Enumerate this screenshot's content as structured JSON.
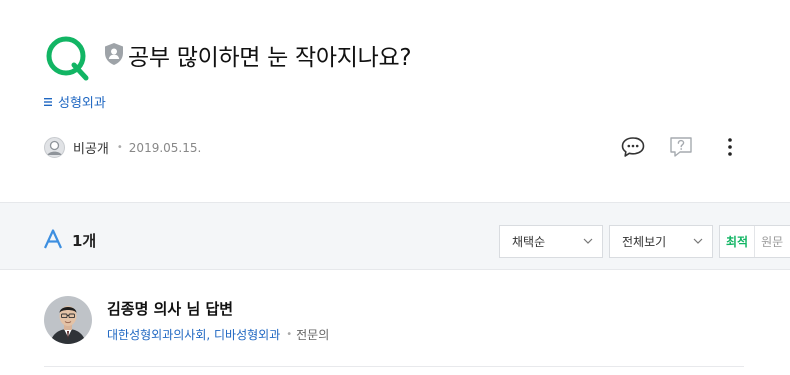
{
  "question": {
    "title": "공부 많이하면 눈 작아지나요?",
    "category": "성형외과",
    "author": "비공개",
    "date": "2019.05.15."
  },
  "answers": {
    "count_label": "1개",
    "sort_select": {
      "value": "채택순"
    },
    "view_select": {
      "value": "전체보기"
    },
    "tabs": [
      {
        "label": "최적",
        "active": true
      },
      {
        "label": "원문",
        "active": false
      }
    ]
  },
  "answer": {
    "name": "김종명 의사 님 답변",
    "affiliation": "대한성형외과의사회, 디바성형외과",
    "role": "전문의"
  },
  "colors": {
    "accent_green": "#12b564",
    "link_blue": "#1f67c2",
    "band_bg": "#f4f6f8"
  },
  "icons": [
    "q-mark-icon",
    "shield-lock-icon",
    "category-icon",
    "default-avatar-icon",
    "comment-icon",
    "report-question-icon",
    "more-vertical-icon",
    "a-mark-icon",
    "chevron-down-icon",
    "doctor-avatar"
  ]
}
